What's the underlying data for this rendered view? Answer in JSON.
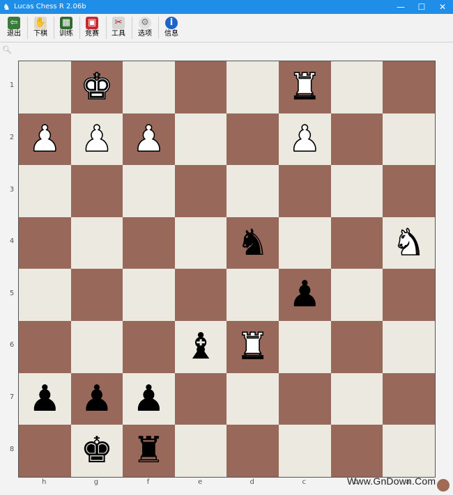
{
  "window": {
    "title": "Lucas Chess R 2.06b",
    "minimize_glyph": "—",
    "maximize_glyph": "☐",
    "close_glyph": "✕"
  },
  "toolbar": {
    "items": [
      {
        "label": "退出",
        "icon": "exit-icon"
      },
      {
        "label": "下棋",
        "icon": "play-icon"
      },
      {
        "label": "训练",
        "icon": "train-icon"
      },
      {
        "label": "竞赛",
        "icon": "compete-icon"
      },
      {
        "label": "工具",
        "icon": "tools-icon"
      },
      {
        "label": "选项",
        "icon": "gear-icon"
      },
      {
        "label": "信息",
        "icon": "info-icon"
      }
    ]
  },
  "board": {
    "light_color": "#ece9e1",
    "dark_color": "#98685a",
    "ranks": [
      "1",
      "2",
      "3",
      "4",
      "5",
      "6",
      "7",
      "8"
    ],
    "files": [
      "h",
      "g",
      "f",
      "e",
      "d",
      "c",
      "b",
      "a"
    ],
    "pieces": [
      {
        "square": "g1",
        "type": "king",
        "color": "white",
        "glyph": "♚"
      },
      {
        "square": "c1",
        "type": "rook",
        "color": "white",
        "glyph": "♜"
      },
      {
        "square": "h2",
        "type": "pawn",
        "color": "white",
        "glyph": "♟"
      },
      {
        "square": "g2",
        "type": "pawn",
        "color": "white",
        "glyph": "♟"
      },
      {
        "square": "f2",
        "type": "pawn",
        "color": "white",
        "glyph": "♟"
      },
      {
        "square": "c2",
        "type": "pawn",
        "color": "white",
        "glyph": "♟"
      },
      {
        "square": "d4",
        "type": "knight",
        "color": "black",
        "glyph": "♞"
      },
      {
        "square": "a4",
        "type": "knight",
        "color": "white",
        "glyph": "♞"
      },
      {
        "square": "c5",
        "type": "pawn",
        "color": "black",
        "glyph": "♟"
      },
      {
        "square": "e6",
        "type": "bishop",
        "color": "black",
        "glyph": "♝"
      },
      {
        "square": "d6",
        "type": "rook",
        "color": "white",
        "glyph": "♜"
      },
      {
        "square": "h7",
        "type": "pawn",
        "color": "black",
        "glyph": "♟"
      },
      {
        "square": "g7",
        "type": "pawn",
        "color": "black",
        "glyph": "♟"
      },
      {
        "square": "f7",
        "type": "pawn",
        "color": "black",
        "glyph": "♟"
      },
      {
        "square": "g8",
        "type": "king",
        "color": "black",
        "glyph": "♚"
      },
      {
        "square": "f8",
        "type": "rook",
        "color": "black",
        "glyph": "♜"
      }
    ]
  },
  "watermark": "Www.GnDown.Com"
}
